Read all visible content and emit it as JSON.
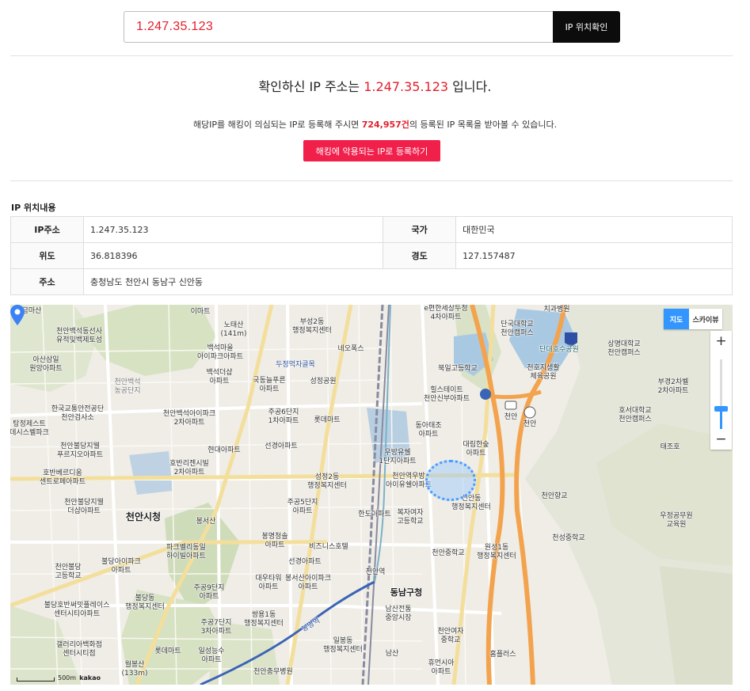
{
  "search": {
    "value": "1.247.35.123",
    "button_label": "IP 위치확인"
  },
  "headline": {
    "prefix": "확인하신 IP 주소는 ",
    "ip": "1.247.35.123",
    "suffix": " 입니다."
  },
  "notice": {
    "prefix": "해당IP를 해킹이 의심되는 IP로 등록해 주시면 ",
    "count": "724,957건",
    "suffix": "의 등록된 IP 목록을 받아볼 수 있습니다."
  },
  "register_button": "해킹에 악용되는 IP로 등록하기",
  "info": {
    "title": "IP 위치내용",
    "rows": [
      {
        "label1": "IP주소",
        "value1": "1.247.35.123",
        "label2": "국가",
        "value2": "대한민국"
      },
      {
        "label1": "위도",
        "value1": "36.818396",
        "label2": "경도",
        "value2": "127.157487"
      }
    ],
    "address_label": "주소",
    "address_value": "충청남도 천안시 동남구 신안동"
  },
  "map": {
    "type_buttons": {
      "map": "지도",
      "skyview": "스카이뷰"
    },
    "zoom_in": "+",
    "zoom_out": "−",
    "scale_label": "500m",
    "provider": "kakao",
    "labels": {
      "l01": "금마산",
      "l02": "천안백석동선사\n유적및백제토성",
      "l03": "아산삼일\n원앙아파트",
      "l04": "한국교통안전공단\n천안검사소",
      "l05": "탕정제스트\n데시스벨파크",
      "l06": "천안불당지웰\n푸르지오아파트",
      "l07": "호반베르디움\n센트로페아파트",
      "l08": "천안불당지웰\n더샵아파트",
      "l09": "천안불당\n고등학교",
      "l10": "불당호반써밋플레이스\n센터시티아파트",
      "l11": "갤러리아백화점\n센터시티점",
      "l12": "천안백석\n농공단지",
      "l13": "이마트",
      "l14": "노태산\n(141m)",
      "l15": "백석마을\n아이파크아파트",
      "l16": "백석더샵\n아파트",
      "l17": "천안백석아이파크\n2차아파트",
      "l18": "현대아파트",
      "l19": "호반리젠시빌\n2차아파트",
      "l20": "천안시청",
      "l21": "봉서산",
      "l22": "파크벨리동일\n하이빌아파트",
      "l23": "불당아이파크\n아파트",
      "l24": "불당동\n행정복지센터",
      "l25": "주공9단지\n아파트",
      "l26": "주공7단지\n3차아파트",
      "l27": "롯데마트",
      "l28": "일성능수\n아파트",
      "l29": "월봉산\n(133m)",
      "l30": "부성2동\n행정복지센터",
      "l31": "네오폭스",
      "l32": "두정먹자골목",
      "l33": "국동늘푸른\n아파트",
      "l34": "성정공원",
      "l35": "주공6단지\n1차아파트",
      "l36": "롯데마트",
      "l37": "선경아파트",
      "l38": "성정2동\n행정복지센터",
      "l39": "주공5단지\n아파트",
      "l40": "봉명청솔\n아파트",
      "l41": "비즈니스호텔",
      "l42": "선경아파트",
      "l43": "대우타워\n아파트",
      "l44": "봉서산아이파크\n아파트",
      "l45": "쌍용1동\n행정복지센터",
      "l46": "일봉동\n행정복지센터",
      "l47": "천안충무병원",
      "l48": "e편한세상두정\n4차아파트",
      "l49": "북일고등학교",
      "l50": "힐스테이트\n천안신부아파트",
      "l51": "동아태조\n아파트",
      "l52": "우방유쉘\n1단지아파트",
      "l53": "천안역우방\n아이유쉘아파트",
      "l54": "대림한숲\n아파트",
      "l55": "한도아파트",
      "l56": "복자여자\n고등학교",
      "l57": "천안중학교",
      "l58": "신안동\n행정복지센터",
      "l59": "원성1동\n행정복지센터",
      "l60": "천안역",
      "l61": "동남구청",
      "l62": "남산전통\n중앙시장",
      "l63": "천안여자\n중학교",
      "l64": "남산",
      "l65": "휴먼시아\n아파트",
      "l66": "홈플러스",
      "l67": "치과병원",
      "l68": "단국대학교\n천안캠퍼스",
      "l69": "단대호수공원",
      "l70": "천호지생활\n체육공원",
      "l71": "상명대학교\n천안캠퍼스",
      "l72": "부경2차벨\n2차아파트",
      "l73": "호서대학교\n천안캠퍼스",
      "l74": "태조호",
      "l75": "천안향교",
      "l76": "우정공무원\n교육원",
      "l77": "천성중학교",
      "l78": "천안",
      "l79": "천안",
      "l80": "봉명역"
    }
  }
}
